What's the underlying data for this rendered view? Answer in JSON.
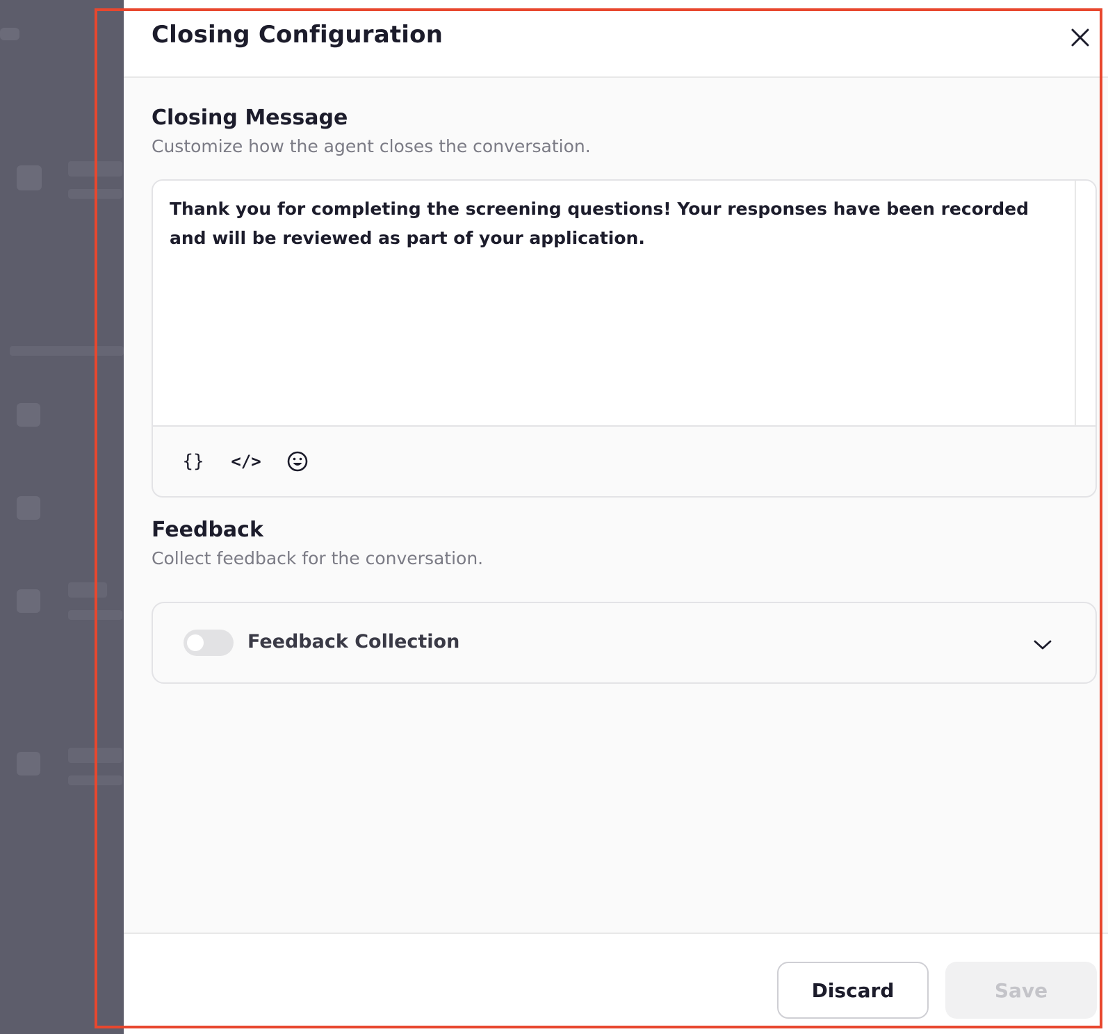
{
  "drawer": {
    "title": "Closing Configuration",
    "close_icon": "close-icon"
  },
  "closing_message": {
    "title": "Closing Message",
    "subtitle": "Customize how the agent closes the conversation.",
    "text": "Thank you for completing the screening questions! Your responses have been recorded and will be reviewed as part of your application.",
    "toolbar": [
      {
        "icon": "variable-braces-icon",
        "glyph": "{}"
      },
      {
        "icon": "code-icon",
        "glyph": "</>"
      },
      {
        "icon": "emoji-icon",
        "glyph": "☺"
      }
    ]
  },
  "feedback": {
    "title": "Feedback",
    "subtitle": "Collect feedback for the conversation.",
    "toggle_label": "Feedback Collection",
    "toggle_on": false
  },
  "footer": {
    "discard_label": "Discard",
    "save_label": "Save"
  },
  "colors": {
    "highlight": "#e8472e",
    "backdrop": "#5d5d6b",
    "text_primary": "#1c1c2b",
    "text_secondary": "#7b7b85"
  }
}
